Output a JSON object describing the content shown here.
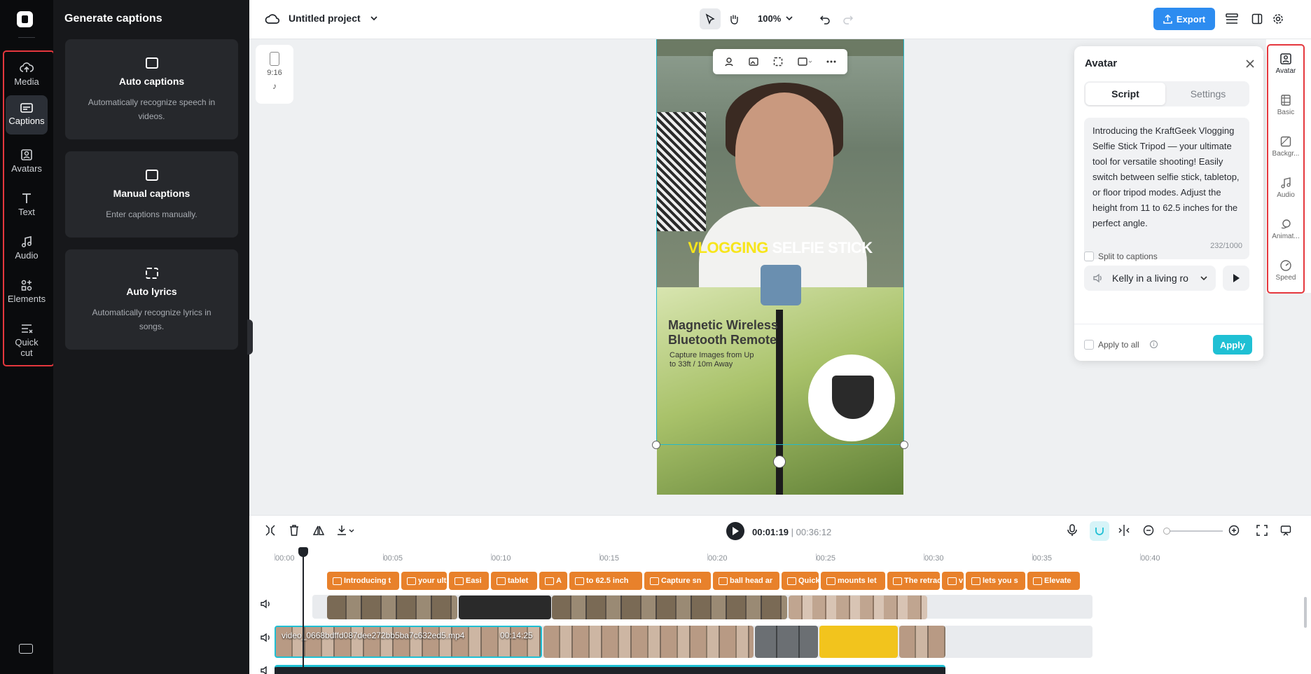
{
  "rail": {
    "items": [
      {
        "label": "Media"
      },
      {
        "label": "Captions"
      },
      {
        "label": "Avatars"
      },
      {
        "label": "Text"
      },
      {
        "label": "Audio"
      },
      {
        "label": "Elements"
      },
      {
        "label": "Quick cut"
      }
    ],
    "active": "Captions"
  },
  "captions_panel": {
    "title": "Generate captions",
    "cards": [
      {
        "title": "Auto captions",
        "desc": "Automatically recognize speech in videos.",
        "icon": "cc-icon"
      },
      {
        "title": "Manual captions",
        "desc": "Enter captions manually.",
        "icon": "keyboard-icon"
      },
      {
        "title": "Auto lyrics",
        "desc": "Automatically recognize lyrics in songs.",
        "icon": "lyrics-icon"
      }
    ]
  },
  "topbar": {
    "project_title": "Untitled project",
    "zoom": "100%",
    "export_label": "Export"
  },
  "canvas": {
    "ratio": "9:16",
    "caption_overlay_highlight": "VLOGGING",
    "caption_overlay_rest": "SELFIE STICK",
    "product_title": "Magnetic Wireless Bluetooth Remote",
    "product_sub": "Capture Images from Up to 33ft / 10m Away"
  },
  "avatar_panel": {
    "title": "Avatar",
    "tabs": [
      "Script",
      "Settings"
    ],
    "script": "Introducing the KraftGeek Vlogging Selfie Stick Tripod — your ultimate tool for versatile shooting! Easily switch between selfie stick, tabletop, or floor tripod modes. Adjust the height from 11 to 62.5 inches for the perfect angle.",
    "char_count": "232/1000",
    "voice": "Kelly in a living ro",
    "split_label": "Split to captions",
    "apply_all_label": "Apply to all",
    "apply_label": "Apply"
  },
  "right_strip": {
    "items": [
      {
        "label": "Avatar"
      },
      {
        "label": "Basic"
      },
      {
        "label": "Backgr..."
      },
      {
        "label": "Audio"
      },
      {
        "label": "Animat..."
      },
      {
        "label": "Speed"
      }
    ]
  },
  "timeline": {
    "current_time": "00:01:19",
    "duration": "00:36:12",
    "ruler": [
      "00:00",
      "00:05",
      "00:10",
      "00:15",
      "00:20",
      "00:25",
      "00:30",
      "00:35",
      "00:40"
    ],
    "captions": [
      "Introducing t",
      "your ult",
      "Easi",
      "tablet",
      "A",
      "to 62.5 inch",
      "Capture sn",
      "ball head ar",
      "Quick",
      "mounts let",
      "The retract",
      "v",
      "lets you s",
      "Elevate"
    ],
    "main_clip_name": "video_0668bdffd087dee272bb5ba7c632ed5.mp4",
    "main_clip_duration": "00:14:25"
  },
  "colors": {
    "accent": "#1fc0d4",
    "export": "#2d8cf0",
    "caption_clip": "#e8812b",
    "highlight_box": "#e5373d"
  }
}
